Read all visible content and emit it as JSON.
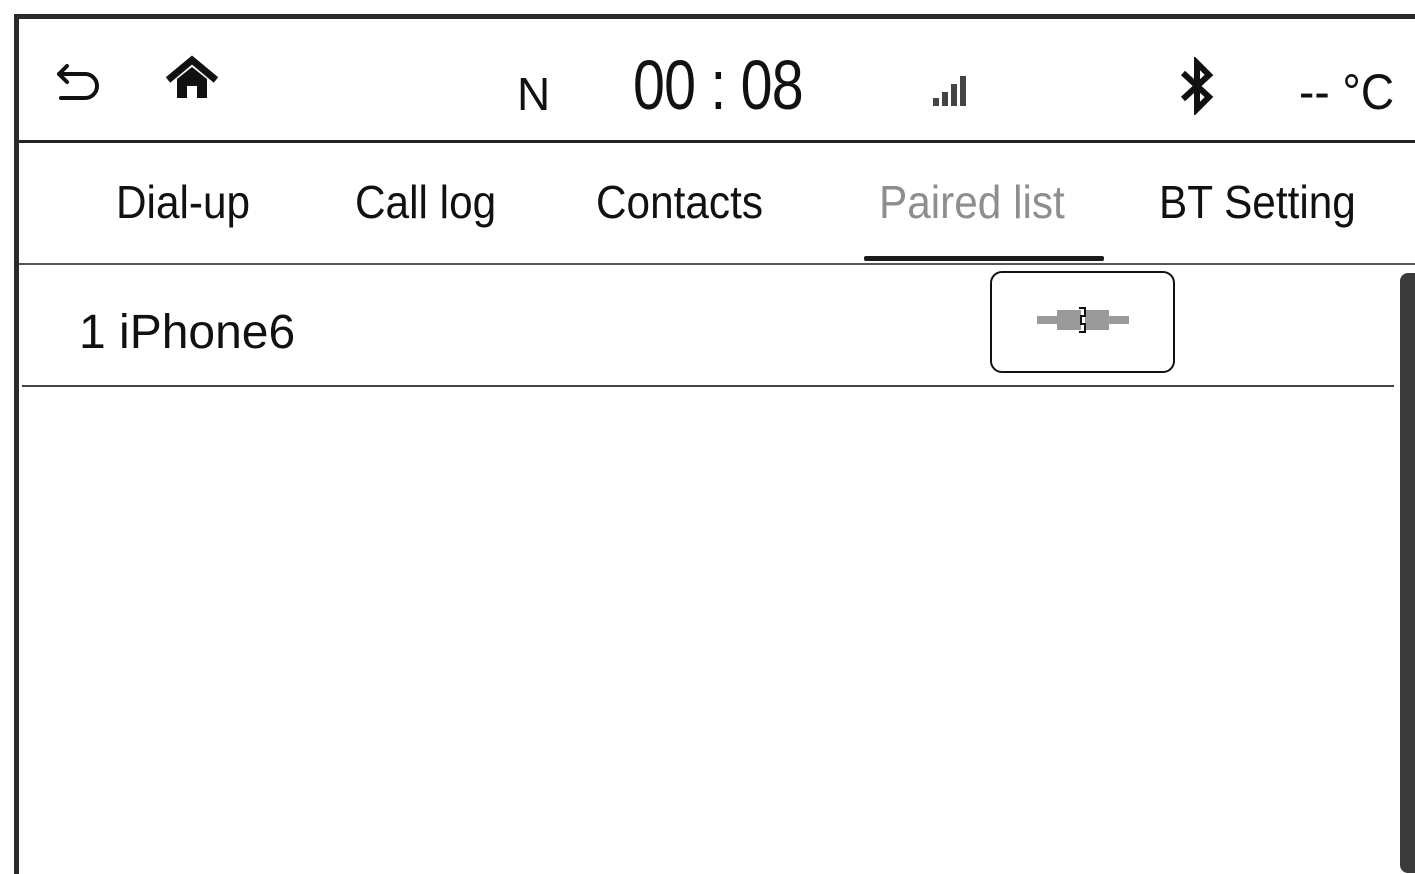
{
  "status": {
    "back_icon": "back-arrow-icon",
    "home_icon": "home-icon",
    "gear": "N",
    "time": "00 : 08",
    "signal_icon": "signal-strength-icon",
    "bluetooth_icon": "bluetooth-icon",
    "temperature": "-- °C"
  },
  "tabs": [
    {
      "label": "Dial-up"
    },
    {
      "label": "Call log"
    },
    {
      "label": "Contacts"
    },
    {
      "label": "Paired list",
      "active": true
    },
    {
      "label": "BT Setting"
    }
  ],
  "paired_devices": [
    {
      "label": "1 iPhone6",
      "action_icon": "connect-plug-icon"
    }
  ],
  "colors": {
    "active_tab_text": "#8e8e8e",
    "connector_gray": "#9a9a9a"
  }
}
